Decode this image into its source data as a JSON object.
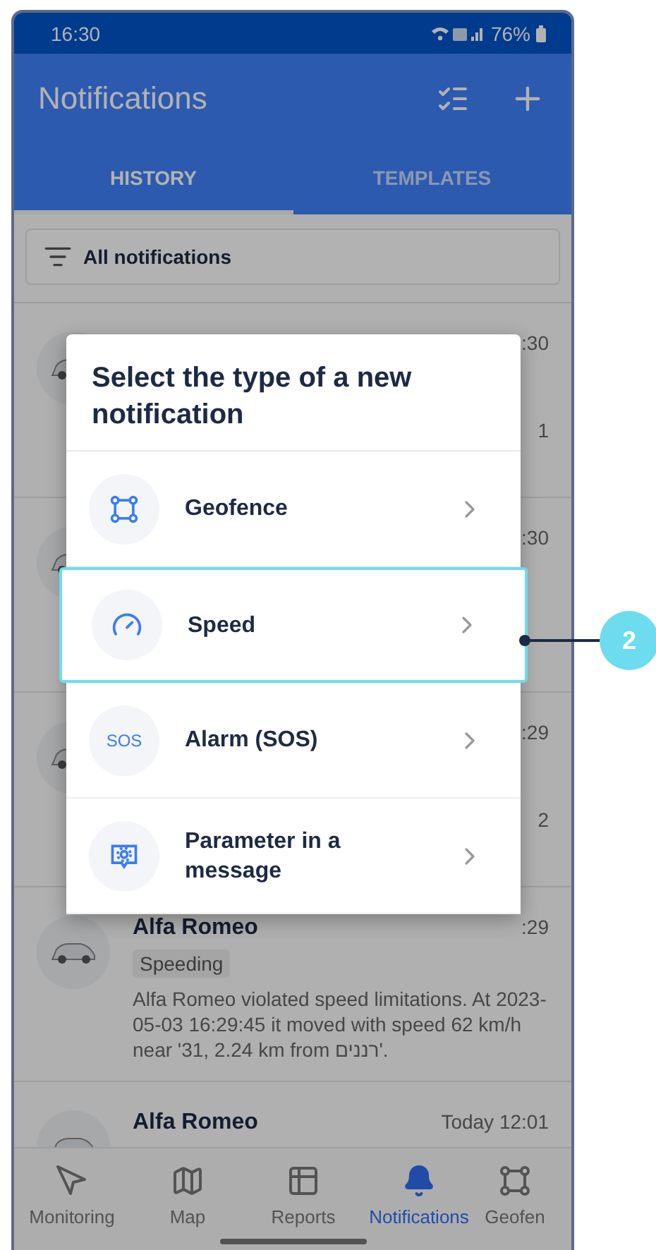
{
  "status_bar": {
    "time": "16:30",
    "battery": "76%"
  },
  "app_bar": {
    "title": "Notifications"
  },
  "tabs": [
    {
      "label": "HISTORY",
      "selected": true
    },
    {
      "label": "TEMPLATES",
      "selected": false
    }
  ],
  "filter": {
    "label": "All notifications"
  },
  "notifications": [
    {
      "time": ":30",
      "tail": "1"
    },
    {
      "time": ":30"
    },
    {
      "time": ":29",
      "tail": "2"
    },
    {
      "title": "Alfa Romeo",
      "time": ":29",
      "tag": "Speeding",
      "body": "Alfa Romeo violated speed limitations. At 2023-05-03 16:29:45 it moved with speed 62 km/h near '31, 2.24 km from רננים'."
    },
    {
      "title": "Alfa Romeo",
      "time": "Today 12:01"
    }
  ],
  "dialog": {
    "title": "Select the type of a new notification",
    "options": [
      {
        "kind": "geofence",
        "label": "Geofence",
        "highlighted": false
      },
      {
        "kind": "speed",
        "label": "Speed",
        "highlighted": true
      },
      {
        "kind": "sos",
        "icon_text": "SOS",
        "label": "Alarm (SOS)",
        "highlighted": false
      },
      {
        "kind": "parameter",
        "label": "Parameter in a message",
        "highlighted": false
      }
    ]
  },
  "callout": {
    "label": "2"
  },
  "nav": [
    {
      "kind": "monitoring",
      "label": "Monitoring",
      "selected": false
    },
    {
      "kind": "map",
      "label": "Map",
      "selected": false
    },
    {
      "kind": "reports",
      "label": "Reports",
      "selected": false
    },
    {
      "kind": "notifications",
      "label": "Notifications",
      "selected": true
    },
    {
      "kind": "geofence",
      "label": "Geofen",
      "selected": false
    }
  ]
}
